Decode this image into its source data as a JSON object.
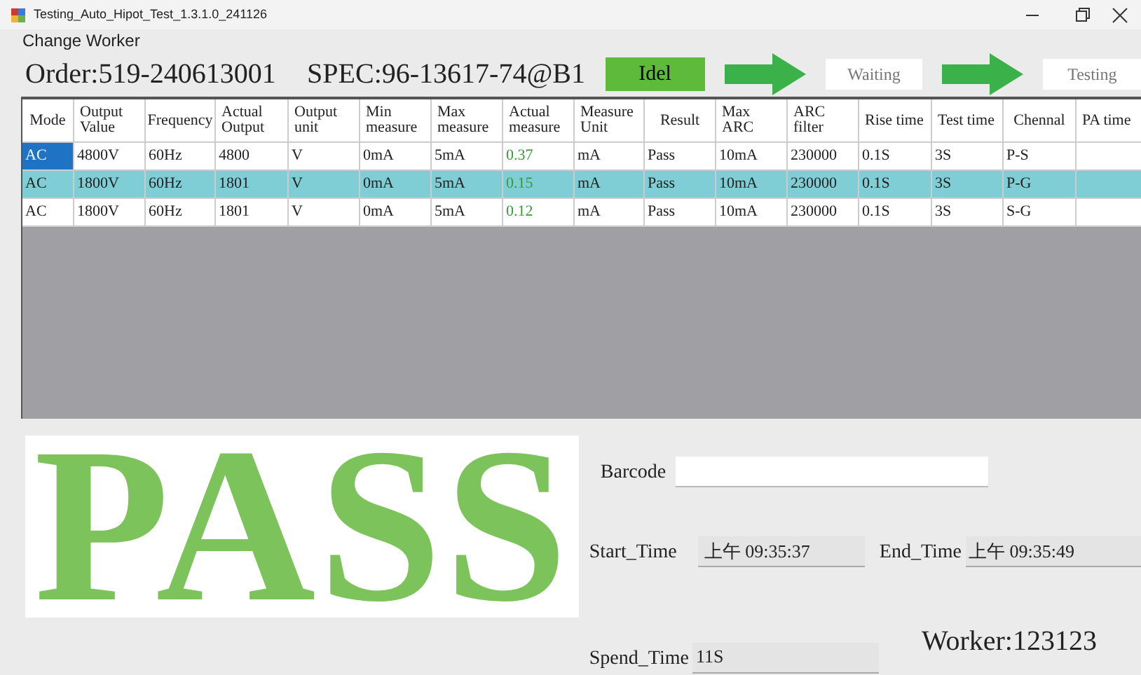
{
  "window": {
    "title": "Testing_Auto_Hipot_Test_1.3.1.0_241126"
  },
  "menu": [
    "Change Worker"
  ],
  "order": "Order:519-240613001",
  "spec": "SPEC:96-13617-74@B1",
  "steps": [
    {
      "label": "Idel",
      "active": true
    },
    {
      "label": "Waiting",
      "active": false
    },
    {
      "label": "Testing",
      "active": false
    }
  ],
  "table": {
    "columns": [
      "Mode",
      "Output Value",
      "Frequency",
      "Actual Output",
      "Output unit",
      "Min measure",
      "Max measure",
      "Actual measure",
      "Measure Unit",
      "Result",
      "Max ARC",
      "ARC filter",
      "Rise time",
      "Test time",
      "Chennal",
      "PA time"
    ],
    "rows": [
      {
        "selected": false,
        "focused": true,
        "cells": [
          "AC",
          "4800V",
          "60Hz",
          "4800",
          "V",
          "0mA",
          "5mA",
          "0.37",
          "mA",
          "Pass",
          "10mA",
          "230000",
          "0.1S",
          "3S",
          "P-S",
          ""
        ]
      },
      {
        "selected": true,
        "focused": false,
        "cells": [
          "AC",
          "1800V",
          "60Hz",
          "1801",
          "V",
          "0mA",
          "5mA",
          "0.15",
          "mA",
          "Pass",
          "10mA",
          "230000",
          "0.1S",
          "3S",
          "P-G",
          ""
        ]
      },
      {
        "selected": false,
        "focused": false,
        "cells": [
          "AC",
          "1800V",
          "60Hz",
          "1801",
          "V",
          "0mA",
          "5mA",
          "0.12",
          "mA",
          "Pass",
          "10mA",
          "230000",
          "0.1S",
          "3S",
          "S-G",
          ""
        ]
      }
    ]
  },
  "result": "PASS",
  "barcode": {
    "label": "Barcode"
  },
  "start_time": {
    "label": "Start_Time",
    "value": "上午 09:35:37"
  },
  "end_time": {
    "label": "End_Time",
    "value": "上午 09:35:49"
  },
  "spend_time": {
    "label": "Spend_Time",
    "value": "11S"
  },
  "worker": "Worker:123123"
}
